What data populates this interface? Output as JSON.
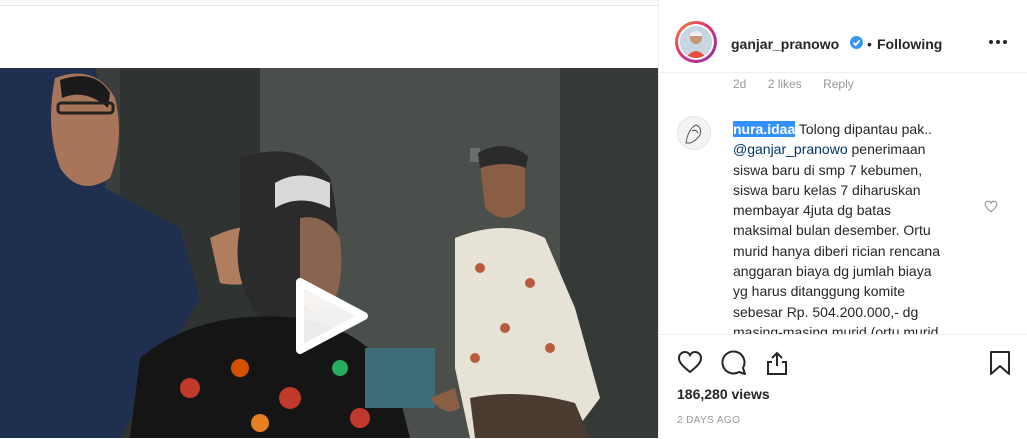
{
  "post": {
    "username": "ganjar_pranowo",
    "separator": "•",
    "follow_status": "Following",
    "views": "186,280 views",
    "posted_ago": "2 DAYS AGO"
  },
  "previous_comment_meta": {
    "age": "2d",
    "likes": "2 likes",
    "reply": "Reply"
  },
  "comment": {
    "user": "nura.idaa",
    "text_before_mention": " Tolong dipantau pak..\n",
    "mention": "@ganjar_pranowo",
    "text_after_mention": " penerimaan\nsiswa baru di smp 7 kebumen,\nsiswa baru kelas 7 diharuskan\nmembayar 4juta dg batas\nmaksimal bulan desember. Ortu\nmurid hanya diberi rician rencana\nanggaran biaya dg jumlah biaya\nyg harus ditanggung komite\nsebesar Rp. 504.200.000,- dg\nmasing-masing murid (ortu murid"
  },
  "icons": [
    "play-icon",
    "verified-badge-icon",
    "more-options-icon",
    "heart-icon",
    "comment-icon",
    "share-icon",
    "bookmark-icon"
  ],
  "colors": {
    "verified": "#3897f0",
    "username_highlight": "#3390ff",
    "mention": "#003569",
    "secondary_text": "#999999"
  }
}
